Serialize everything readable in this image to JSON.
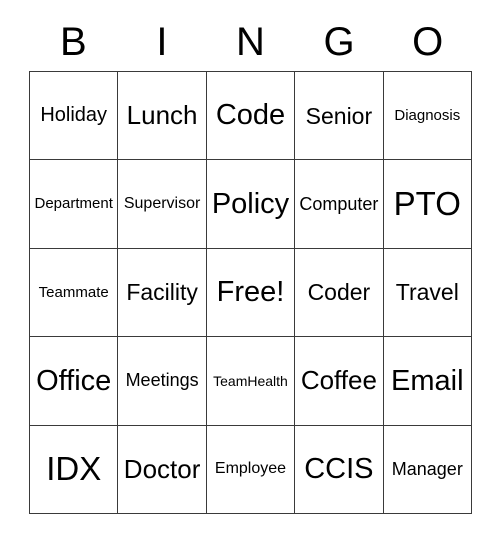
{
  "card": {
    "header_letters": [
      "B",
      "I",
      "N",
      "G",
      "O"
    ],
    "columns": 5,
    "rows": 5,
    "free_space_label": "Free!",
    "colors": {
      "background": "#ffffff",
      "text": "#000000",
      "grid_line": "#3a3a3a"
    },
    "cells": [
      [
        {
          "label": "Holiday",
          "size": "fs-ml"
        },
        {
          "label": "Lunch",
          "size": "fs-xl"
        },
        {
          "label": "Code",
          "size": "fs-xxl"
        },
        {
          "label": "Senior",
          "size": "fs-l"
        },
        {
          "label": "Diagnosis",
          "size": "fs-s"
        }
      ],
      [
        {
          "label": "Department",
          "size": "fs-s"
        },
        {
          "label": "Supervisor",
          "size": "fs-sm"
        },
        {
          "label": "Policy",
          "size": "fs-xxl"
        },
        {
          "label": "Computer",
          "size": "fs-m"
        },
        {
          "label": "PTO",
          "size": "fs-xxxl"
        }
      ],
      [
        {
          "label": "Teammate",
          "size": "fs-s"
        },
        {
          "label": "Facility",
          "size": "fs-l"
        },
        {
          "label": "Free!",
          "size": "fs-xxl"
        },
        {
          "label": "Coder",
          "size": "fs-l"
        },
        {
          "label": "Travel",
          "size": "fs-l"
        }
      ],
      [
        {
          "label": "Office",
          "size": "fs-xxl"
        },
        {
          "label": "Meetings",
          "size": "fs-m"
        },
        {
          "label": "TeamHealth",
          "size": "fs-xs"
        },
        {
          "label": "Coffee",
          "size": "fs-xl"
        },
        {
          "label": "Email",
          "size": "fs-xxl"
        }
      ],
      [
        {
          "label": "IDX",
          "size": "fs-xxxl"
        },
        {
          "label": "Doctor",
          "size": "fs-xl"
        },
        {
          "label": "Employee",
          "size": "fs-sm"
        },
        {
          "label": "CCIS",
          "size": "fs-xxl"
        },
        {
          "label": "Manager",
          "size": "fs-m"
        }
      ]
    ]
  }
}
